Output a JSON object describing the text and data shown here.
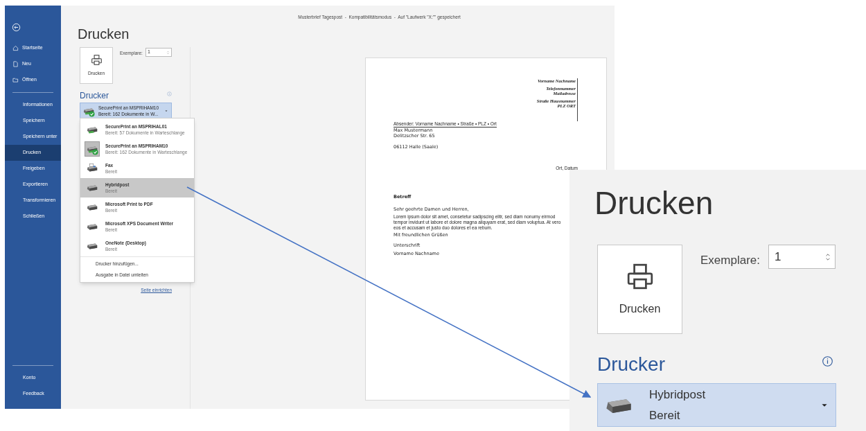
{
  "title_bar": {
    "text": "Musterbrief Tagespost  -  Kompatibilitätsmodus  -  Auf \"Laufwerk \"X:\"\" gespeichert"
  },
  "sidebar": {
    "top_items": [
      {
        "label": "Startseite"
      },
      {
        "label": "Neu"
      },
      {
        "label": "Öffnen"
      }
    ],
    "items": [
      {
        "label": "Informationen",
        "selected": false
      },
      {
        "label": "Speichern",
        "selected": false
      },
      {
        "label": "Speichern unter",
        "selected": false
      },
      {
        "label": "Drucken",
        "selected": true
      },
      {
        "label": "Freigeben",
        "selected": false
      },
      {
        "label": "Exportieren",
        "selected": false
      },
      {
        "label": "Transformieren",
        "selected": false
      },
      {
        "label": "Schließen",
        "selected": false
      }
    ],
    "bottom_items": [
      {
        "label": "Konto"
      },
      {
        "label": "Feedback"
      }
    ]
  },
  "heading": "Drucken",
  "print_button": {
    "label": "Drucken"
  },
  "copies": {
    "label": "Exemplare:",
    "value": "1"
  },
  "printer": {
    "heading": "Drucker",
    "name": "SecurePrint an MSPRIHAM10",
    "status": "Bereit: 162 Dokumente in W..."
  },
  "printer_menu": {
    "printers": [
      {
        "name": "SecurePrint an MSPRIHAL01",
        "status": "Bereit: 57 Dokumente in Warteschlange",
        "kind": "network",
        "selected": false,
        "hovered": false,
        "default": false
      },
      {
        "name": "SecurePrint an MSPRIHAM10",
        "status": "Bereit: 162 Dokumente in Warteschlange",
        "kind": "network",
        "selected": true,
        "hovered": false,
        "default": true
      },
      {
        "name": "Fax",
        "status": "Bereit",
        "kind": "fax",
        "selected": false,
        "hovered": false,
        "default": false
      },
      {
        "name": "Hybridpost",
        "status": "Bereit",
        "kind": "local",
        "selected": false,
        "hovered": true,
        "default": false
      },
      {
        "name": "Microsoft Print to PDF",
        "status": "Bereit",
        "kind": "local",
        "selected": false,
        "hovered": false,
        "default": false
      },
      {
        "name": "Microsoft XPS Document Writer",
        "status": "Bereit",
        "kind": "local",
        "selected": false,
        "hovered": false,
        "default": false
      },
      {
        "name": "OneNote (Desktop)",
        "status": "Bereit",
        "kind": "local",
        "selected": false,
        "hovered": false,
        "default": false
      }
    ],
    "actions": [
      "Drucker hinzufügen...",
      "Ausgabe in Datei umleiten"
    ]
  },
  "page_setup_link": "Seite einrichten",
  "preview": {
    "header_lines": [
      "Vorname Nachname",
      "Telefonnummer",
      "Mailadresse",
      "Straße Hausnummer",
      "PLZ ORT"
    ],
    "sender_line": "Absender: Vorname Nachname • Straße • PLZ • Ort",
    "address_lines": [
      "Max Mustermann",
      "Delitzscher Str. 65"
    ],
    "city_line": "06112 Halle (Saale)",
    "place_date": "Ort, Datum",
    "subject": "Betreff",
    "salutation": "Sehr geehrte Damen und Herren,",
    "body": "Lorem ipsum dolor sit amet, consetetur sadipscing elitr, sed diam nonumy eirmod tempor invidunt ut labore et dolore magna aliquyam erat, sed diam voluptua. At vero eos et accusam et justo duo dolores et ea rebum.",
    "closing": "Mit freundlichen Grüßen",
    "signature": "Unterschrift",
    "signer": "Vorname Nachname"
  },
  "zoom_inset": {
    "heading": "Drucken",
    "print_button": "Drucken",
    "copies_label": "Exemplare:",
    "copies_value": "1",
    "printer_heading": "Drucker",
    "printer_name": "Hybridpost",
    "printer_status": "Bereit"
  }
}
